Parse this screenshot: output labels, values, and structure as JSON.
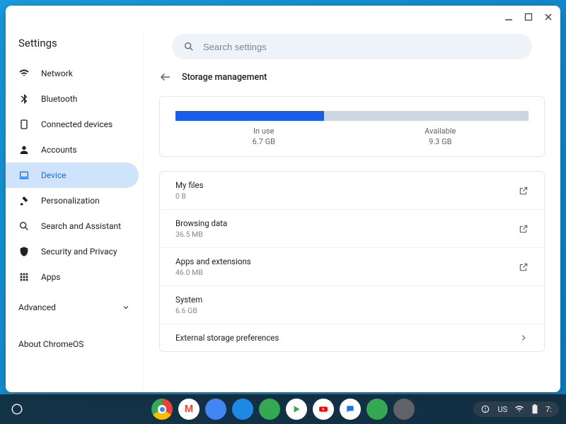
{
  "app_title": "Settings",
  "search": {
    "placeholder": "Search settings"
  },
  "sidebar": {
    "items": [
      {
        "label": "Network"
      },
      {
        "label": "Bluetooth"
      },
      {
        "label": "Connected devices"
      },
      {
        "label": "Accounts"
      },
      {
        "label": "Device"
      },
      {
        "label": "Personalization"
      },
      {
        "label": "Search and Assistant"
      },
      {
        "label": "Security and Privacy"
      },
      {
        "label": "Apps"
      }
    ],
    "advanced_label": "Advanced",
    "about_label": "About ChromeOS"
  },
  "page": {
    "title": "Storage management",
    "in_use": {
      "label": "In use",
      "value": "6.7 GB"
    },
    "available": {
      "label": "Available",
      "value": "9.3 GB"
    },
    "used_percent": 42,
    "items": [
      {
        "title": "My files",
        "sub": "0 B",
        "action": "external"
      },
      {
        "title": "Browsing data",
        "sub": "36.5 MB",
        "action": "external"
      },
      {
        "title": "Apps and extensions",
        "sub": "46.0 MB",
        "action": "external"
      },
      {
        "title": "System",
        "sub": "6.6 GB",
        "action": "none"
      },
      {
        "title": "External storage preferences",
        "sub": "",
        "action": "chevron"
      }
    ]
  },
  "shelf": {
    "status": {
      "lang": "US",
      "time": "7:"
    }
  }
}
